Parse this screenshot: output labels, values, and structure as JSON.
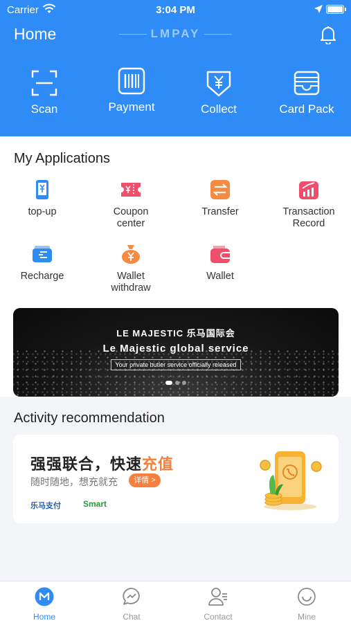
{
  "status_bar": {
    "carrier": "Carrier",
    "time": "3:04 PM",
    "battery_level": 1.0
  },
  "header": {
    "title": "Home",
    "brand": "LMPAY",
    "quick_actions": [
      {
        "label": "Scan",
        "icon": "scan-icon"
      },
      {
        "label": "Payment",
        "icon": "barcode-icon"
      },
      {
        "label": "Collect",
        "icon": "yen-shield-icon"
      },
      {
        "label": "Card Pack",
        "icon": "wallet-card-icon"
      }
    ]
  },
  "applications": {
    "title": "My Applications",
    "items": [
      {
        "label": "top-up",
        "icon": "phone-yen-icon",
        "color": "#2f8bf5"
      },
      {
        "label": "Coupon center",
        "icon": "ticket-icon",
        "color": "#ef4e6c"
      },
      {
        "label": "Transfer",
        "icon": "transfer-icon",
        "color": "#f58a42"
      },
      {
        "label": "Transaction Record",
        "icon": "chart-record-icon",
        "color": "#ef4e6c"
      },
      {
        "label": "Recharge",
        "icon": "card-recharge-icon",
        "color": "#2f8bf5"
      },
      {
        "label": "Wallet withdraw",
        "icon": "money-bag-icon",
        "color": "#f58a42"
      },
      {
        "label": "Wallet",
        "icon": "wallet-icon",
        "color": "#ef4e6c"
      }
    ]
  },
  "banner": {
    "logo": "LE MAJESTIC 乐马国际会",
    "headline": "Le Majestic global service",
    "tagline": "Your private butler service officially released"
  },
  "activity": {
    "title": "Activity recommendation",
    "card": {
      "headline_main": "强强联合，快速",
      "headline_accent": "充值",
      "subtitle": "随时随地，想充就充",
      "button": "详情 >",
      "partner_1": "乐马支付",
      "partner_2": "Smart"
    }
  },
  "tabbar": {
    "tabs": [
      {
        "label": "Home",
        "icon": "home-m-icon",
        "active": true
      },
      {
        "label": "Chat",
        "icon": "chat-icon",
        "active": false
      },
      {
        "label": "Contact",
        "icon": "contact-icon",
        "active": false
      },
      {
        "label": "Mine",
        "icon": "smile-icon",
        "active": false
      }
    ]
  },
  "colors": {
    "primary": "#2f8bf5",
    "accent": "#f5803e",
    "background": "#f4f5f8"
  }
}
